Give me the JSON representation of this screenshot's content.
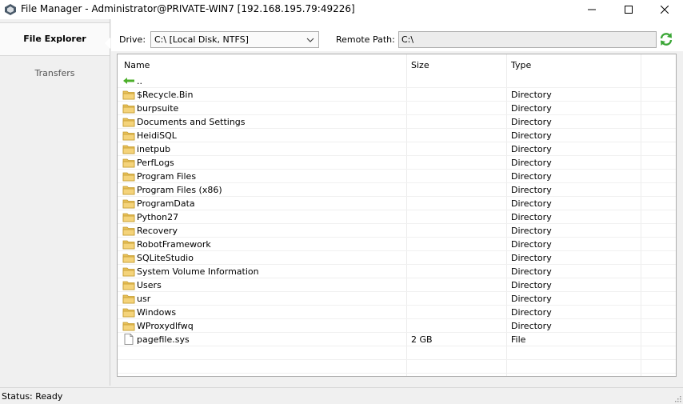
{
  "window": {
    "title": "File Manager - Administrator@PRIVATE-WIN7 [192.168.195.79:49226]"
  },
  "sidebar": {
    "tabs": [
      {
        "label": "File Explorer",
        "active": true
      },
      {
        "label": "Transfers",
        "active": false
      }
    ]
  },
  "toolbar": {
    "drive_label": "Drive:",
    "drive_value": "C:\\ [Local Disk, NTFS]",
    "remote_path_label": "Remote Path:",
    "remote_path_value": "C:\\"
  },
  "file_list": {
    "columns": [
      "Name",
      "Size",
      "Type"
    ],
    "rows": [
      {
        "name": "..",
        "size": "",
        "type": "",
        "icon": "back-arrow-icon"
      },
      {
        "name": "$Recycle.Bin",
        "size": "",
        "type": "Directory",
        "icon": "folder-icon"
      },
      {
        "name": "burpsuite",
        "size": "",
        "type": "Directory",
        "icon": "folder-icon"
      },
      {
        "name": "Documents and Settings",
        "size": "",
        "type": "Directory",
        "icon": "folder-icon"
      },
      {
        "name": "HeidiSQL",
        "size": "",
        "type": "Directory",
        "icon": "folder-icon"
      },
      {
        "name": "inetpub",
        "size": "",
        "type": "Directory",
        "icon": "folder-icon"
      },
      {
        "name": "PerfLogs",
        "size": "",
        "type": "Directory",
        "icon": "folder-icon"
      },
      {
        "name": "Program Files",
        "size": "",
        "type": "Directory",
        "icon": "folder-icon"
      },
      {
        "name": "Program Files (x86)",
        "size": "",
        "type": "Directory",
        "icon": "folder-icon"
      },
      {
        "name": "ProgramData",
        "size": "",
        "type": "Directory",
        "icon": "folder-icon"
      },
      {
        "name": "Python27",
        "size": "",
        "type": "Directory",
        "icon": "folder-icon"
      },
      {
        "name": "Recovery",
        "size": "",
        "type": "Directory",
        "icon": "folder-icon"
      },
      {
        "name": "RobotFramework",
        "size": "",
        "type": "Directory",
        "icon": "folder-icon"
      },
      {
        "name": "SQLiteStudio",
        "size": "",
        "type": "Directory",
        "icon": "folder-icon"
      },
      {
        "name": "System Volume Information",
        "size": "",
        "type": "Directory",
        "icon": "folder-icon"
      },
      {
        "name": "Users",
        "size": "",
        "type": "Directory",
        "icon": "folder-icon"
      },
      {
        "name": "usr",
        "size": "",
        "type": "Directory",
        "icon": "folder-icon"
      },
      {
        "name": "Windows",
        "size": "",
        "type": "Directory",
        "icon": "folder-icon"
      },
      {
        "name": "WProxydlfwq",
        "size": "",
        "type": "Directory",
        "icon": "folder-icon"
      },
      {
        "name": "pagefile.sys",
        "size": "2 GB",
        "type": "File",
        "icon": "file-icon"
      }
    ]
  },
  "status": {
    "text": "Status: Ready"
  },
  "colors": {
    "folder": "#e8c15a",
    "back_arrow": "#4caf2a",
    "refresh": "#3aa635"
  }
}
